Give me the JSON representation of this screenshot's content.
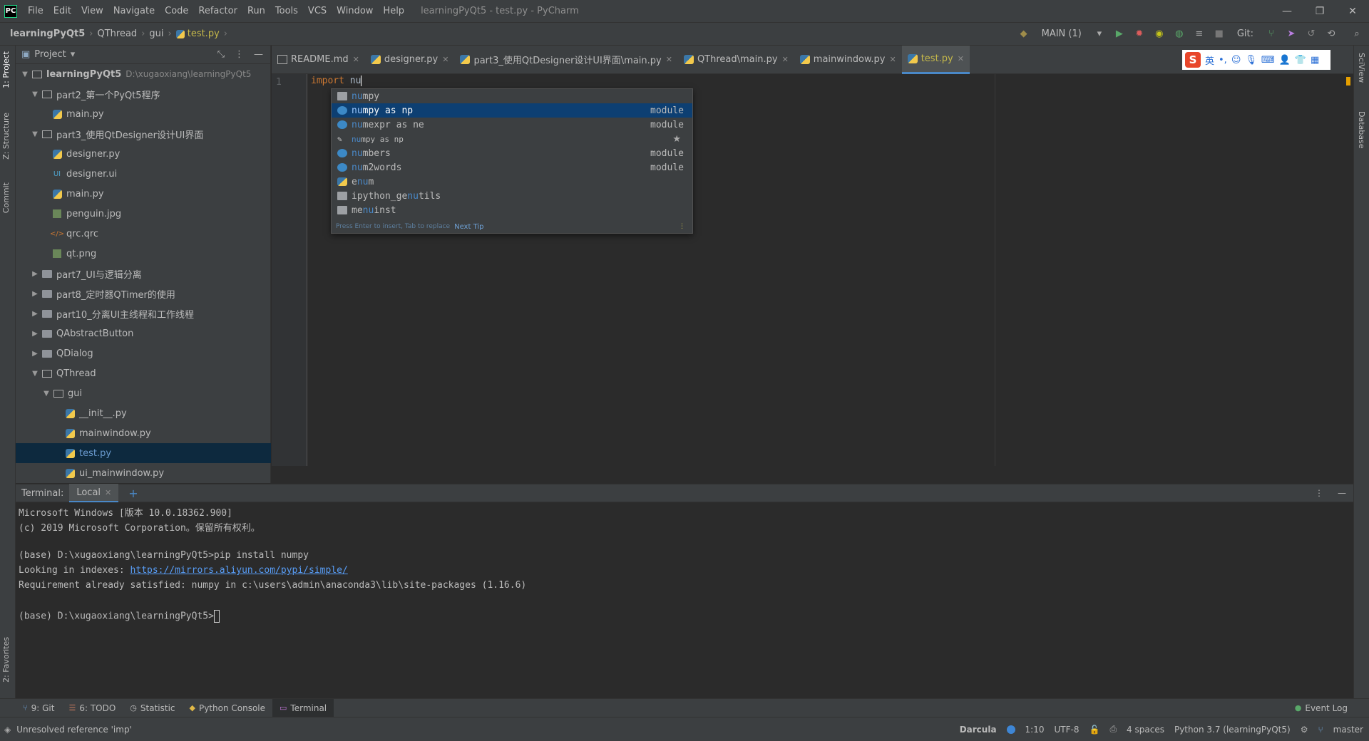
{
  "app": {
    "window_title": "learningPyQt5 - test.py - PyCharm",
    "logo_text": "PC"
  },
  "menu": [
    "File",
    "Edit",
    "View",
    "Navigate",
    "Code",
    "Refactor",
    "Run",
    "Tools",
    "VCS",
    "Window",
    "Help"
  ],
  "window_controls": {
    "minimize": "—",
    "maximize": "❐",
    "close": "✕"
  },
  "breadcrumb": {
    "root": "learningPyQt5",
    "items": [
      "QThread",
      "gui"
    ],
    "file": "test.py"
  },
  "run_toolbar": {
    "config": "MAIN (1)",
    "git_label": "Git:"
  },
  "left_tabs": {
    "project": "1: Project",
    "structure": "Z: Structure",
    "commit": "Commit",
    "favorites": "2: Favorites"
  },
  "right_tabs": {
    "sciview": "SciView",
    "database": "Database"
  },
  "project_panel": {
    "title": "Project",
    "root": {
      "name": "learningPyQt5",
      "path": "D:\\xugaoxiang\\learningPyQt5"
    },
    "items": [
      {
        "label": "part2_第一个PyQt5程序"
      },
      {
        "label": "main.py"
      },
      {
        "label": "part3_使用QtDesigner设计UI界面"
      },
      {
        "label": "designer.py"
      },
      {
        "label": "designer.ui"
      },
      {
        "label": "main.py"
      },
      {
        "label": "penguin.jpg"
      },
      {
        "label": "qrc.qrc"
      },
      {
        "label": "qt.png"
      },
      {
        "label": "part7_UI与逻辑分离"
      },
      {
        "label": "part8_定时器QTimer的使用"
      },
      {
        "label": "part10_分离UI主线程和工作线程"
      },
      {
        "label": "QAbstractButton"
      },
      {
        "label": "QDialog"
      },
      {
        "label": "QThread"
      },
      {
        "label": "gui"
      },
      {
        "label": "__init__.py"
      },
      {
        "label": "mainwindow.py"
      },
      {
        "label": "test.py"
      },
      {
        "label": "ui_mainwindow.py"
      }
    ]
  },
  "editor_tabs": [
    {
      "label": "README.md"
    },
    {
      "label": "designer.py"
    },
    {
      "label": "part3_使用QtDesigner设计UI界面\\main.py"
    },
    {
      "label": "QThread\\main.py"
    },
    {
      "label": "mainwindow.py"
    },
    {
      "label": "test.py"
    }
  ],
  "ime_toolbar": {
    "logo": "S",
    "mode": "英"
  },
  "editor": {
    "line_number": "1",
    "keyword": "import",
    "typed": "nu"
  },
  "completion": {
    "items": [
      {
        "match": "nu",
        "rest": "mpy",
        "type": ""
      },
      {
        "match": "nu",
        "rest": "mpy as np",
        "type": "module"
      },
      {
        "match": "nu",
        "rest": "mexpr as ne",
        "type": "module"
      },
      {
        "match": "nu",
        "rest": "mpy as np",
        "type": ""
      },
      {
        "match": "nu",
        "rest": "mbers",
        "type": "module"
      },
      {
        "match": "nu",
        "rest": "m2words",
        "type": "module"
      },
      {
        "pre": "e",
        "match": "nu",
        "rest": "m",
        "type": ""
      },
      {
        "pre": "ipython_ge",
        "match": "nu",
        "rest": "tils",
        "type": ""
      },
      {
        "pre": "me",
        "match": "nu",
        "rest": "inst",
        "type": ""
      }
    ],
    "footer": "Press Enter to insert, Tab to replace",
    "next_tip": "Next Tip"
  },
  "terminal": {
    "label": "Terminal:",
    "tab": "Local",
    "lines": [
      "Microsoft Windows [版本 10.0.18362.900]",
      "(c) 2019 Microsoft Corporation。保留所有权利。",
      "",
      "(base) D:\\xugaoxiang\\learningPyQt5>pip install numpy",
      "Looking in indexes: ",
      "Requirement already satisfied: numpy in c:\\users\\admin\\anaconda3\\lib\\site-packages (1.16.6)",
      "",
      "(base) D:\\xugaoxiang\\learningPyQt5>"
    ],
    "link": "https://mirrors.aliyun.com/pypi/simple/"
  },
  "tool_windows": {
    "git": "9: Git",
    "todo": "6: TODO",
    "statistic": "Statistic",
    "python_console": "Python Console",
    "terminal": "Terminal",
    "event_log": "Event Log"
  },
  "status": {
    "message": "Unresolved reference 'imp'",
    "theme": "Darcula",
    "position": "1:10",
    "encoding": "UTF-8",
    "indent": "4 spaces",
    "interpreter": "Python 3.7 (learningPyQt5)",
    "branch": "master"
  }
}
